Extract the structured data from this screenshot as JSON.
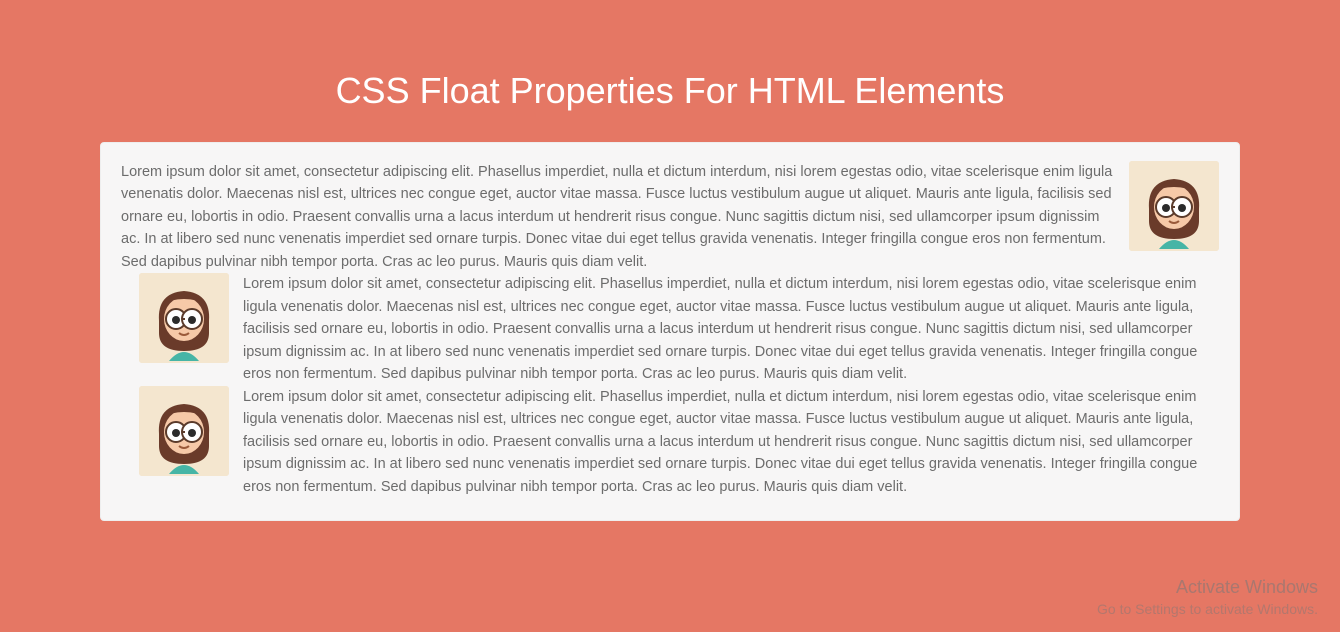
{
  "title": "CSS Float Properties For HTML Elements",
  "paragraphs": {
    "p1": "Lorem ipsum dolor sit amet, consectetur adipiscing elit. Phasellus imperdiet, nulla et dictum interdum, nisi lorem egestas odio, vitae scelerisque enim ligula venenatis dolor. Maecenas nisl est, ultrices nec congue eget, auctor vitae massa. Fusce luctus vestibulum augue ut aliquet. Mauris ante ligula, facilisis sed ornare eu, lobortis in odio. Praesent convallis urna a lacus interdum ut hendrerit risus congue. Nunc sagittis dictum nisi, sed ullamcorper ipsum dignissim ac. In at libero sed nunc venenatis imperdiet sed ornare turpis. Donec vitae dui eget tellus gravida venenatis. Integer fringilla congue eros non fermentum. Sed dapibus pulvinar nibh tempor porta. Cras ac leo purus. Mauris quis diam velit.",
    "p2": "Lorem ipsum dolor sit amet, consectetur adipiscing elit. Phasellus imperdiet, nulla et dictum interdum, nisi lorem egestas odio, vitae scelerisque enim ligula venenatis dolor. Maecenas nisl est, ultrices nec congue eget, auctor vitae massa. Fusce luctus vestibulum augue ut aliquet. Mauris ante ligula, facilisis sed ornare eu, lobortis in odio. Praesent convallis urna a lacus interdum ut hendrerit risus congue. Nunc sagittis dictum nisi, sed ullamcorper ipsum dignissim ac. In at libero sed nunc venenatis imperdiet sed ornare turpis. Donec vitae dui eget tellus gravida venenatis. Integer fringilla congue eros non fermentum. Sed dapibus pulvinar nibh tempor porta. Cras ac leo purus. Mauris quis diam velit.",
    "p3": "Lorem ipsum dolor sit amet, consectetur adipiscing elit. Phasellus imperdiet, nulla et dictum interdum, nisi lorem egestas odio, vitae scelerisque enim ligula venenatis dolor. Maecenas nisl est, ultrices nec congue eget, auctor vitae massa. Fusce luctus vestibulum augue ut aliquet. Mauris ante ligula, facilisis sed ornare eu, lobortis in odio. Praesent convallis urna a lacus interdum ut hendrerit risus congue. Nunc sagittis dictum nisi, sed ullamcorper ipsum dignissim ac. In at libero sed nunc venenatis imperdiet sed ornare turpis. Donec vitae dui eget tellus gravida venenatis. Integer fringilla congue eros non fermentum. Sed dapibus pulvinar nibh tempor porta. Cras ac leo purus. Mauris quis diam velit."
  },
  "watermark": {
    "line1": "Activate Windows",
    "line2": "Go to Settings to activate Windows."
  },
  "avatar_icon_name": "girl-glasses-avatar"
}
